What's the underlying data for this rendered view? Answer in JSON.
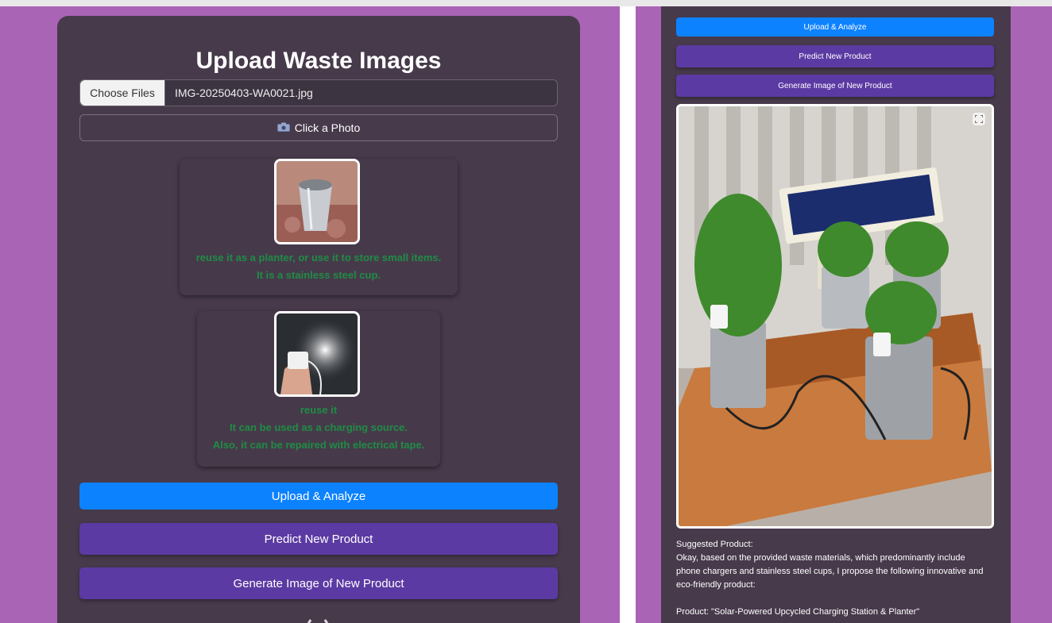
{
  "left_panel": {
    "title": "Upload Waste Images",
    "file_input": {
      "button_label": "Choose Files",
      "file_name": "IMG-20250403-WA0021.jpg"
    },
    "photo_button": {
      "icon": "camera-icon",
      "label": "Click a Photo"
    },
    "results": [
      {
        "lines": [
          "reuse it as a planter, or use it to store small items.",
          "It is a stainless steel cup."
        ]
      },
      {
        "lines": [
          "reuse it",
          "It can be used as a charging source.",
          "Also, it can be repaired with electrical tape."
        ]
      }
    ],
    "buttons": {
      "upload": "Upload & Analyze",
      "predict": "Predict New Product",
      "generate": "Generate Image of New Product"
    }
  },
  "right_panel": {
    "buttons": {
      "upload": "Upload & Analyze",
      "predict": "Predict New Product",
      "generate": "Generate Image of New Product"
    },
    "suggestion": {
      "heading": "Suggested Product:",
      "body_lines": [
        "Okay, based on the provided waste materials, which predominantly include",
        "phone chargers and stainless steel cups, I propose the following innovative and",
        "eco-friendly product:"
      ],
      "product_line": "Product: \"Solar-Powered Upcycled Charging Station & Planter\""
    }
  },
  "colors": {
    "page_bg": "#a964b5",
    "card_bg": "#473a4b",
    "primary_blue": "#0d82ff",
    "action_purple": "#5c3aa3",
    "result_green": "#1f8c45"
  }
}
